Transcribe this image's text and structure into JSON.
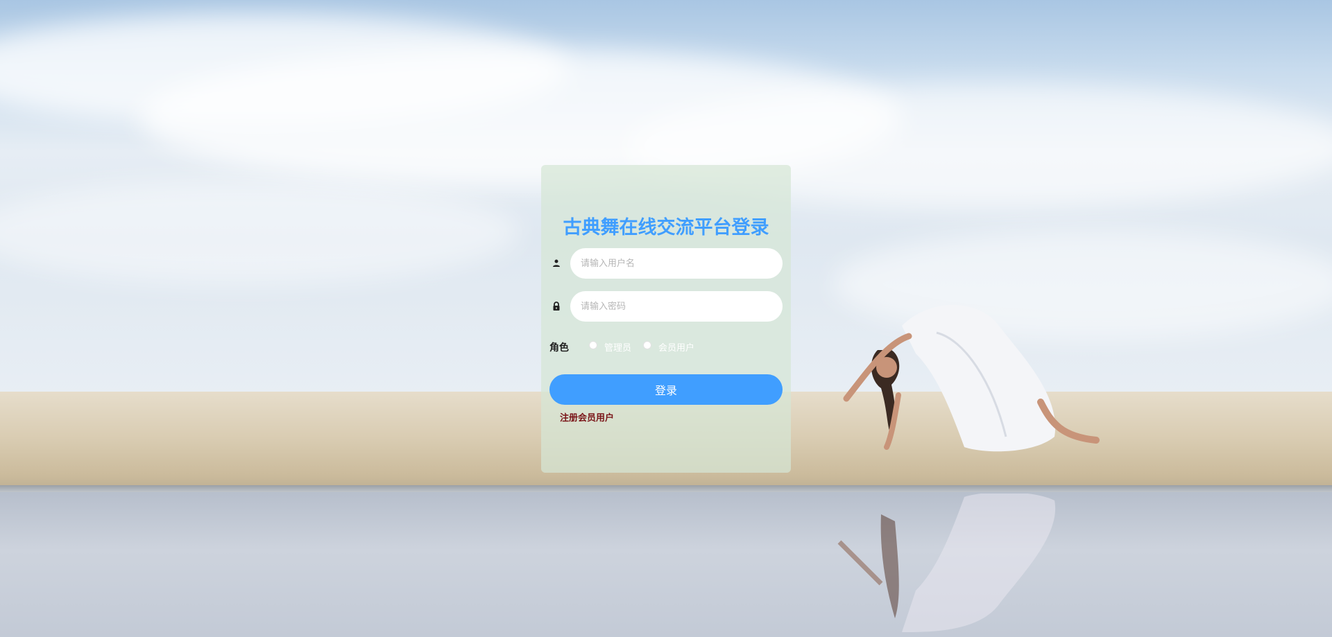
{
  "login": {
    "title": "古典舞在线交流平台登录",
    "username_placeholder": "请输入用户名",
    "password_placeholder": "请输入密码",
    "role_label": "角色",
    "roles": [
      {
        "label": "管理员"
      },
      {
        "label": "会员用户"
      }
    ],
    "login_button": "登录",
    "register_link": "注册会员用户"
  },
  "icons": {
    "username": "user-icon",
    "password": "lock-icon"
  },
  "colors": {
    "accent": "#409eff",
    "register_link": "#7a1518",
    "panel_bg": "#d6e6d6"
  }
}
